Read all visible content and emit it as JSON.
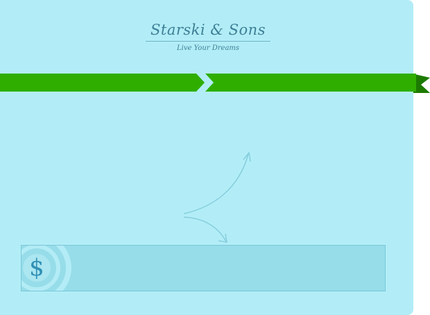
{
  "brand": {
    "name": "Starski & Sons",
    "tagline": "Live Your Dreams"
  },
  "icons": {
    "ribbon": "ribbon-banner-icon",
    "arrows": "curved-arrows-icon",
    "money": "dollar-icon"
  },
  "money_box": {
    "symbol": "$"
  },
  "colors": {
    "background": "#b2edf7",
    "ribbon_green": "#2fae00",
    "ribbon_dark": "#1c7a00",
    "text_teal": "#3d7f95",
    "box_fill": "#96dde9",
    "dollar_blue": "#2f8fb4"
  }
}
